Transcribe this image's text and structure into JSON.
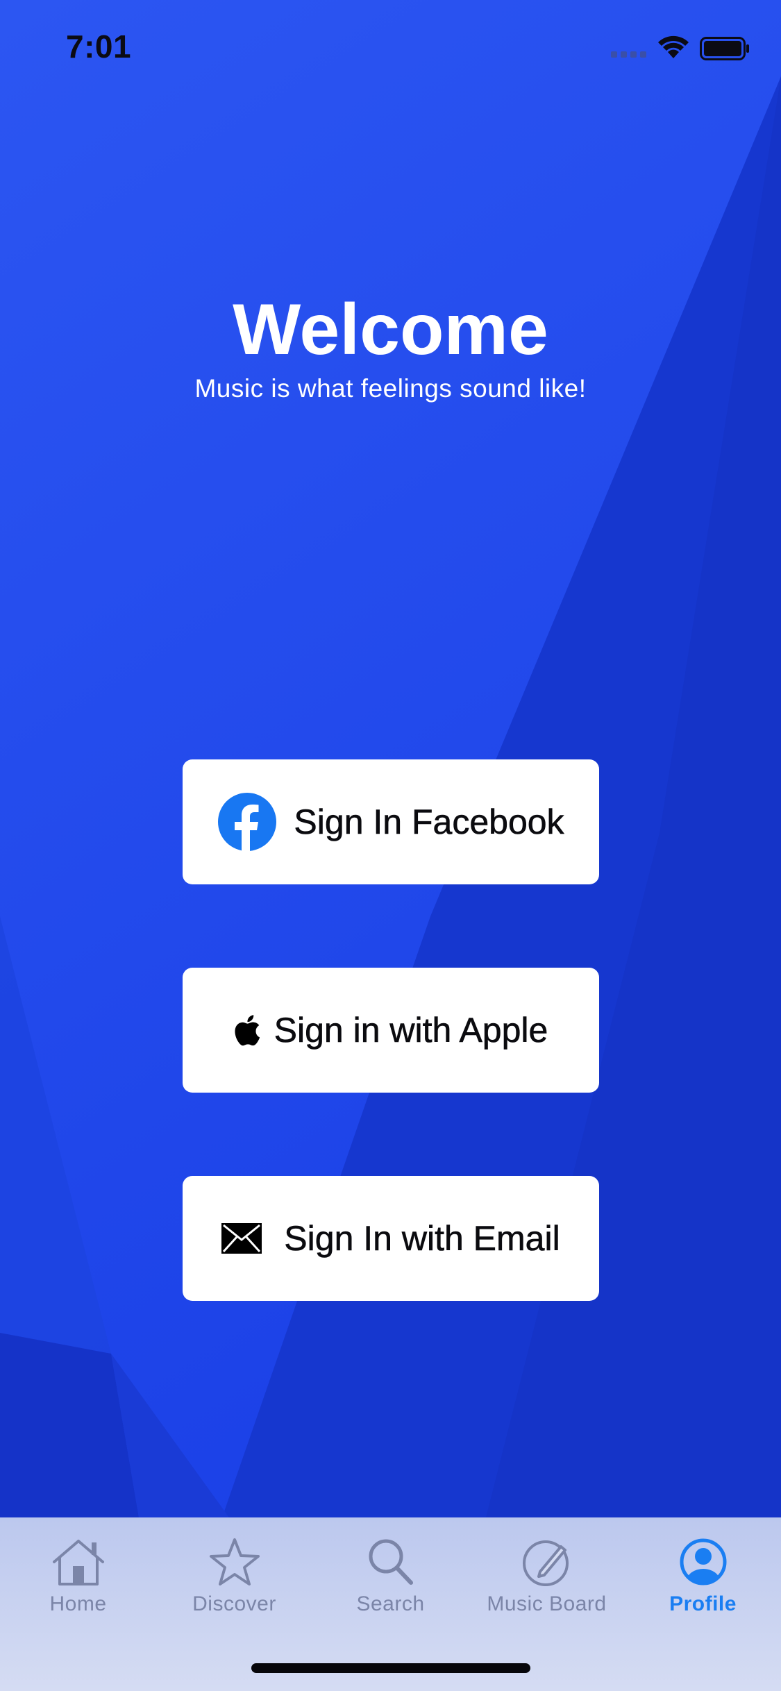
{
  "status_bar": {
    "time": "7:01"
  },
  "welcome": {
    "title": "Welcome",
    "subtitle": "Music is what feelings sound like!"
  },
  "signin": {
    "facebook_label": "Sign In Facebook",
    "apple_label": "Sign in with Apple",
    "email_label": "Sign In with Email"
  },
  "tab_bar": {
    "items": [
      {
        "label": "Home",
        "icon": "house-icon"
      },
      {
        "label": "Discover",
        "icon": "star-icon"
      },
      {
        "label": "Search",
        "icon": "magnifier-icon"
      },
      {
        "label": "Music Board",
        "icon": "pencil-circle-icon"
      },
      {
        "label": "Profile",
        "icon": "person-circle-icon"
      }
    ],
    "active": "Profile"
  },
  "colors": {
    "background": "#1a40e6",
    "facebook_blue": "#1877f2",
    "tab_active": "#1a7ef2",
    "tab_inactive": "#7b85a8"
  }
}
